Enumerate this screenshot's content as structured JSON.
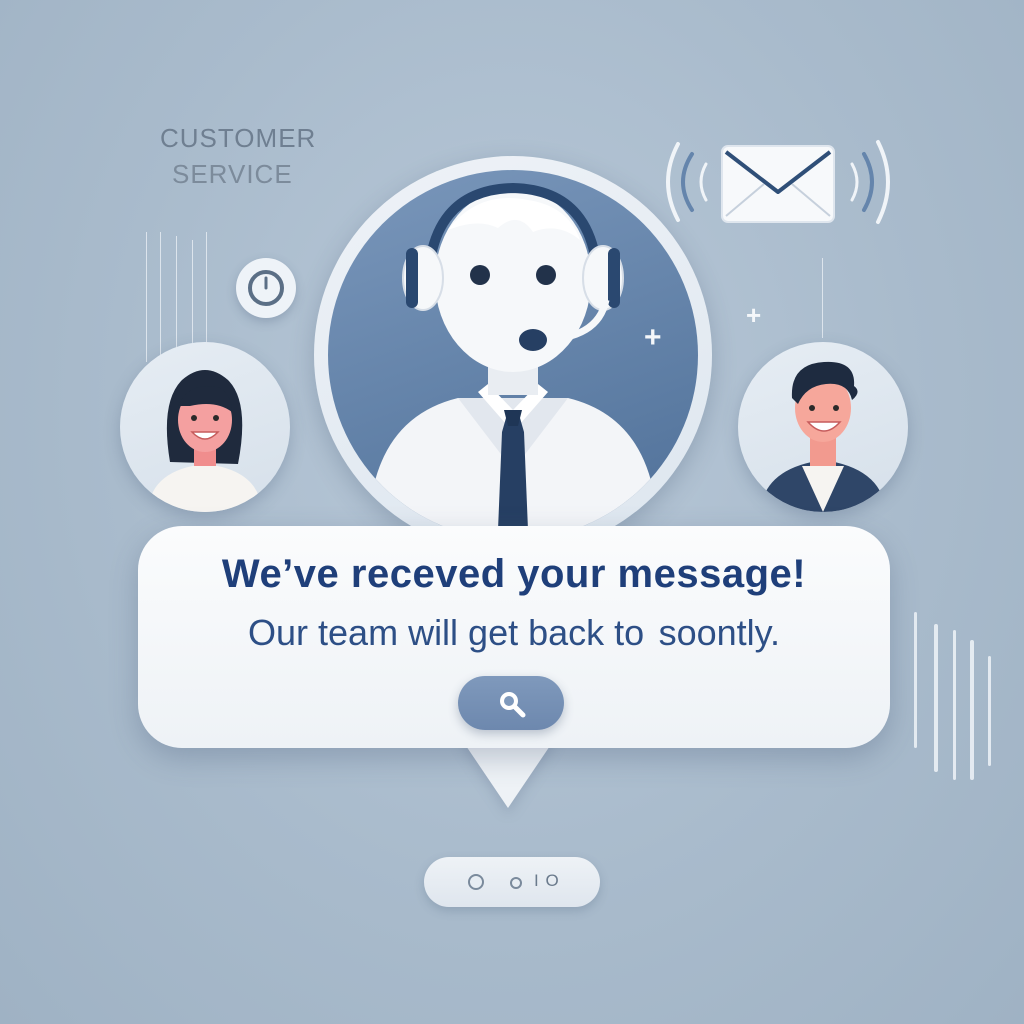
{
  "brand": {
    "line1": "CUSTOMER",
    "line2": "SERVICE"
  },
  "message": {
    "line1": "We’ve receved your message!",
    "line2": "Our team will get back to  soontly."
  },
  "pagination": {
    "text": "I O"
  },
  "icons": [
    "timer-icon",
    "agent-avatar",
    "headset-icon",
    "email-icon",
    "signal-waves-icon",
    "plus-icon",
    "woman-avatar",
    "man-avatar",
    "search-icon",
    "pager-dot"
  ],
  "colors": {
    "background": "#a9bbcc",
    "accent": "#5c7ca3",
    "text_primary": "#1f3f7a",
    "bubble": "#fbfcfd"
  }
}
